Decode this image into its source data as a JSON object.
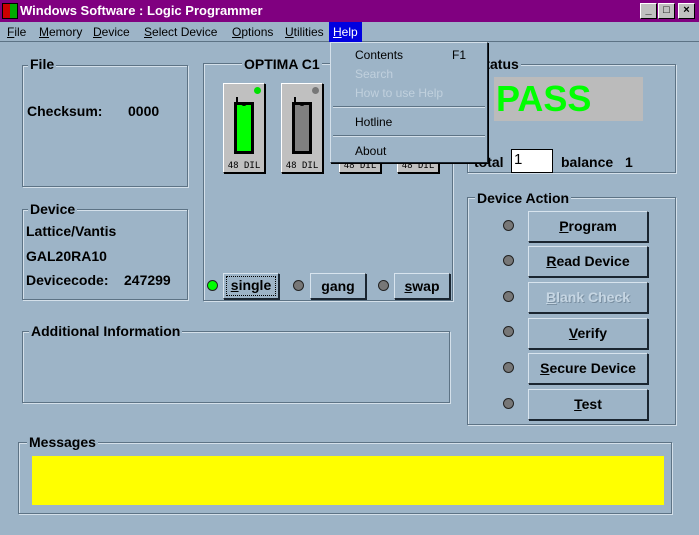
{
  "window": {
    "title": "Windows Software : Logic Programmer",
    "minimize": "_",
    "maximize": "□",
    "close": "×"
  },
  "menubar": [
    "File",
    "Memory",
    "Device",
    "Select Device",
    "Options",
    "Utilities",
    "Help"
  ],
  "help_menu": {
    "items": [
      {
        "label": "Contents",
        "shortcut": "F1",
        "enabled": true
      },
      {
        "label": "Search",
        "enabled": false
      },
      {
        "label": "How to use Help",
        "enabled": false
      },
      {
        "label": "Hotline",
        "enabled": true
      },
      {
        "label": "About",
        "enabled": true
      }
    ]
  },
  "file_group": {
    "title": "File",
    "checksum_label": "Checksum:",
    "checksum_value": "0000"
  },
  "device_group": {
    "title": "Device",
    "manufacturer": "Lattice/Vantis",
    "device": "GAL20RA10",
    "devicecode_label": "Devicecode:",
    "devicecode_value": "247299"
  },
  "programmer": {
    "title": "OPTIMA  C1",
    "sockets": [
      {
        "label": "48 DIL",
        "state": "active",
        "color": "#00ff00"
      },
      {
        "label": "48 DIL",
        "state": "inactive",
        "color": "#808080"
      },
      {
        "label": "48 DIL"
      },
      {
        "label": "48 DIL"
      }
    ],
    "modes": [
      {
        "label": "single",
        "selected": true
      },
      {
        "label": "gang",
        "selected": false
      },
      {
        "label": "swap",
        "selected": false
      }
    ]
  },
  "status": {
    "title": "Status",
    "result": "PASS",
    "result_color": "#00ff00",
    "total_label": "total",
    "total_value": "1",
    "balance_label": "balance",
    "balance_value": "1"
  },
  "device_action": {
    "title": "Device Action",
    "buttons": [
      {
        "label": "Program",
        "enabled": true
      },
      {
        "label": "Read Device",
        "enabled": true
      },
      {
        "label": "Blank Check",
        "enabled": false
      },
      {
        "label": "Verify",
        "enabled": true
      },
      {
        "label": "Secure Device",
        "enabled": true
      },
      {
        "label": "Test",
        "enabled": true
      }
    ]
  },
  "additional_info": {
    "title": "Additional Information"
  },
  "messages": {
    "title": "Messages",
    "text": "",
    "background": "#ffff00"
  }
}
